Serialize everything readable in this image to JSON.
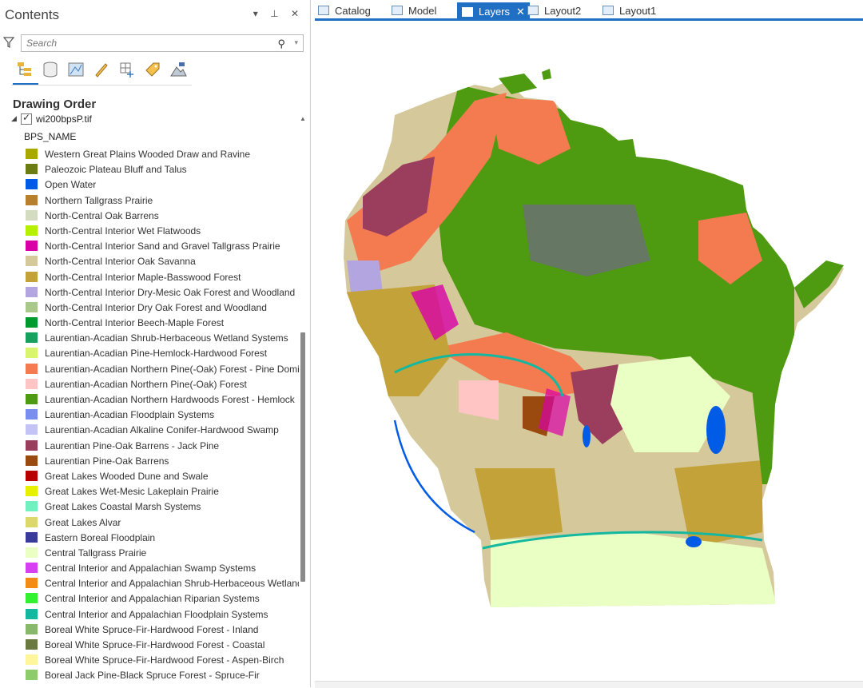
{
  "pane": {
    "title": "Contents",
    "tools": "▾ ⊥ ✕",
    "search_placeholder": "Search",
    "drawing_order": "Drawing Order",
    "layer_name": "wi200bpsP.tif",
    "field_name": "BPS_NAME"
  },
  "legend": [
    {
      "label": "Western Great Plains Wooded Draw and Ravine",
      "color": "#a8a800"
    },
    {
      "label": "Paleozoic Plateau Bluff and Talus",
      "color": "#6b7c12"
    },
    {
      "label": "Open Water",
      "color": "#005ce6"
    },
    {
      "label": "Northern Tallgrass Prairie",
      "color": "#b87f2d"
    },
    {
      "label": "North-Central Oak Barrens",
      "color": "#d3dcc0"
    },
    {
      "label": "North-Central Interior Wet Flatwoods",
      "color": "#b4f000"
    },
    {
      "label": "North-Central Interior Sand and Gravel Tallgrass Prairie",
      "color": "#d900a8"
    },
    {
      "label": "North-Central Interior Oak Savanna",
      "color": "#d5c89a"
    },
    {
      "label": "North-Central Interior Maple-Basswood Forest",
      "color": "#c4a23a"
    },
    {
      "label": "North-Central Interior Dry-Mesic Oak Forest and Woodland",
      "color": "#b3a6e0"
    },
    {
      "label": "North-Central Interior Dry Oak Forest and Woodland",
      "color": "#a8c98a"
    },
    {
      "label": "North-Central Interior Beech-Maple Forest",
      "color": "#009a2e"
    },
    {
      "label": "Laurentian-Acadian Shrub-Herbaceous Wetland Systems",
      "color": "#17a05e"
    },
    {
      "label": "Laurentian-Acadian Pine-Hemlock-Hardwood Forest",
      "color": "#d9f570"
    },
    {
      "label": "Laurentian-Acadian Northern Pine(-Oak) Forest - Pine Dominated",
      "color": "#f47a50"
    },
    {
      "label": "Laurentian-Acadian Northern Pine(-Oak) Forest",
      "color": "#ffc4c4"
    },
    {
      "label": "Laurentian-Acadian Northern Hardwoods Forest - Hemlock",
      "color": "#4e9b12"
    },
    {
      "label": "Laurentian-Acadian Floodplain Systems",
      "color": "#7a8ef2"
    },
    {
      "label": "Laurentian-Acadian Alkaline Conifer-Hardwood Swamp",
      "color": "#c3c3f5"
    },
    {
      "label": "Laurentian Pine-Oak Barrens - Jack Pine",
      "color": "#9b3d5c"
    },
    {
      "label": "Laurentian Pine-Oak Barrens",
      "color": "#9b4a0f"
    },
    {
      "label": "Great Lakes Wooded Dune and Swale",
      "color": "#b80000"
    },
    {
      "label": "Great Lakes Wet-Mesic Lakeplain Prairie",
      "color": "#e6f000"
    },
    {
      "label": "Great Lakes Coastal Marsh Systems",
      "color": "#73f0c0"
    },
    {
      "label": "Great Lakes Alvar",
      "color": "#dcd86a"
    },
    {
      "label": "Eastern Boreal Floodplain",
      "color": "#3a3a9c"
    },
    {
      "label": "Central Tallgrass Prairie",
      "color": "#eaffc4"
    },
    {
      "label": "Central Interior and Appalachian Swamp Systems",
      "color": "#d640f0"
    },
    {
      "label": "Central Interior and Appalachian Shrub-Herbaceous Wetland Systems",
      "color": "#f28c14"
    },
    {
      "label": "Central Interior and Appalachian Riparian Systems",
      "color": "#33f033"
    },
    {
      "label": "Central Interior and Appalachian Floodplain Systems",
      "color": "#14b8a0"
    },
    {
      "label": "Boreal White Spruce-Fir-Hardwood Forest - Inland",
      "color": "#88b86a"
    },
    {
      "label": "Boreal White Spruce-Fir-Hardwood Forest - Coastal",
      "color": "#6a7a40"
    },
    {
      "label": "Boreal White Spruce-Fir-Hardwood Forest - Aspen-Birch",
      "color": "#fff59a"
    },
    {
      "label": "Boreal Jack Pine-Black Spruce Forest - Spruce-Fir",
      "color": "#8ecb6a"
    }
  ],
  "tabs": [
    {
      "label": "Catalog",
      "icon": "catalog-icon"
    },
    {
      "label": "Model",
      "icon": "model-icon"
    },
    {
      "label": "Layers",
      "icon": "map-icon",
      "active": true
    },
    {
      "label": "Layout2",
      "icon": "layout-icon"
    },
    {
      "label": "Layout1",
      "icon": "layout-icon"
    }
  ],
  "colors": {
    "accent": "#1f6fc5"
  }
}
